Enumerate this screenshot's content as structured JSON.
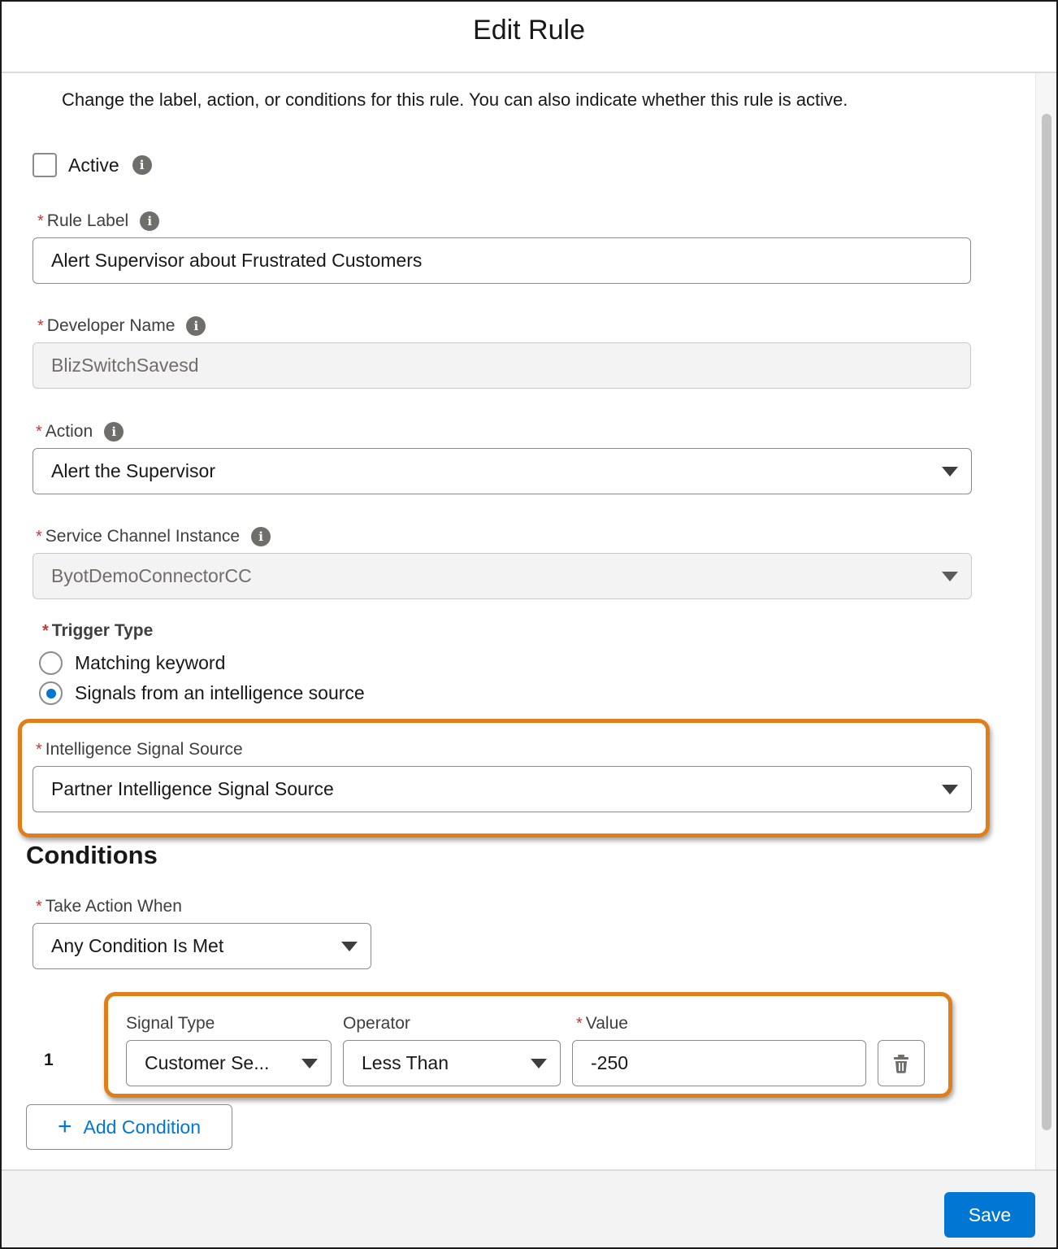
{
  "modal": {
    "title": "Edit Rule",
    "description": "Change the label, action, or conditions for this rule. You can also indicate whether this rule is active."
  },
  "active": {
    "label": "Active",
    "checked": false
  },
  "rule_label": {
    "label": "Rule Label",
    "value": "Alert Supervisor about Frustrated Customers"
  },
  "developer_name": {
    "label": "Developer Name",
    "value": "BlizSwitchSavesd"
  },
  "action": {
    "label": "Action",
    "value": "Alert the Supervisor"
  },
  "service_channel": {
    "label": "Service Channel Instance",
    "value": "ByotDemoConnectorCC"
  },
  "trigger_type": {
    "label": "Trigger Type",
    "options": [
      {
        "label": "Matching keyword",
        "selected": false
      },
      {
        "label": "Signals from an intelligence source",
        "selected": true
      }
    ]
  },
  "signal_source": {
    "label": "Intelligence Signal Source",
    "value": "Partner Intelligence Signal Source"
  },
  "conditions": {
    "title": "Conditions",
    "take_action_label": "Take Action When",
    "take_action_value": "Any Condition Is Met",
    "rows": [
      {
        "number": "1",
        "signal_type_label": "Signal Type",
        "signal_type_value": "Customer Se...",
        "operator_label": "Operator",
        "operator_value": "Less Than",
        "value_label": "Value",
        "value": "-250"
      }
    ],
    "add_label": "Add Condition"
  },
  "footer": {
    "save_label": "Save"
  },
  "colors": {
    "brand": "#0176d3",
    "highlight": "#e07f1a",
    "required": "#c23934"
  },
  "icons": [
    "info-icon",
    "chevron-down-icon",
    "trash-icon",
    "plus-icon"
  ]
}
